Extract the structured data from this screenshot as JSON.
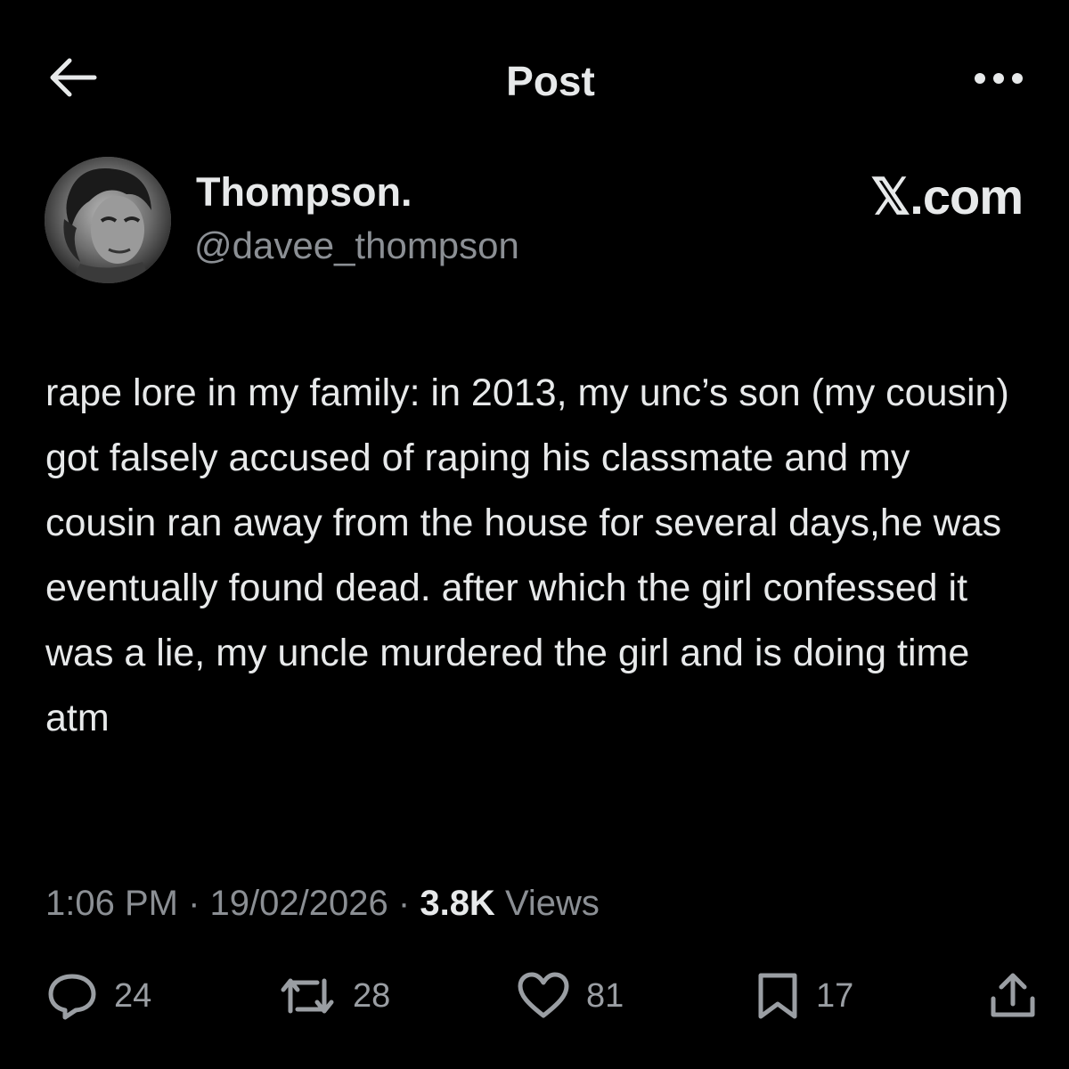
{
  "header": {
    "title": "Post",
    "back_icon": "arrow-left-icon",
    "more_icon": "more-horizontal-icon"
  },
  "author": {
    "display_name": "Thompson.",
    "handle": "@davee_thompson"
  },
  "brand": {
    "label": "𝕏.com"
  },
  "post": {
    "text": "rape lore in my family: in 2013, my unc’s son (my cousin) got falsely accused of raping his classmate and my cousin ran away from the house for several days,he was eventually found dead. after which the girl confessed it was a lie, my uncle murdered the girl and is doing time atm"
  },
  "meta": {
    "time": "1:06 PM",
    "date": "19/02/2026",
    "views_count": "3.8K",
    "views_label": "Views",
    "separator": "·"
  },
  "actions": {
    "replies": "24",
    "reposts": "28",
    "likes": "81",
    "bookmarks": "17"
  },
  "colors": {
    "background": "#000000",
    "text_primary": "#e7e9ea",
    "text_secondary": "#8b8f94"
  }
}
